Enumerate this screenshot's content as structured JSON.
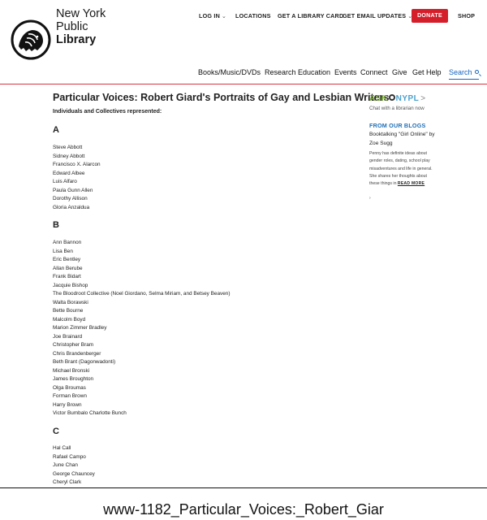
{
  "brand": {
    "line1": "New York",
    "line2": "Public",
    "line3": "Library",
    "logo_icon": "lion-logo-icon"
  },
  "utility_nav": {
    "login": "LOG IN",
    "locations": "LOCATIONS",
    "library_card": "GET A LIBRARY CARD",
    "email_updates": "GET EMAIL UPDATES",
    "donate": "DONATE",
    "shop": "SHOP",
    "caret": "⌄"
  },
  "main_nav": {
    "items": [
      "Books/Music/DVDs",
      "Research",
      "Education",
      "Events",
      "Connect",
      "Give",
      "Get Help"
    ],
    "search": "Search"
  },
  "colors": {
    "accent_red": "#d41f2b",
    "rule_red": "#d6373f",
    "link_blue": "#1565c0",
    "ask_green": "#7aab3a",
    "blog_blue": "#1e6fb5"
  },
  "article": {
    "title": "Particular Voices: Robert Giard's Portraits of Gay and Lesbian Writers",
    "subtitle": "Individuals and Collectives represented:",
    "sections": [
      {
        "letter": "A",
        "names": [
          "Steve Abbott",
          "Sidney Abbott",
          "Francisco X. Alarcon",
          "Edward Albee",
          "Luis Alfaro",
          "Paula Gunn Allen",
          "Dorothy Allison",
          "Gloria Anzaldua"
        ]
      },
      {
        "letter": "B",
        "names": [
          "Ann Bannon",
          "Lisa Ben",
          "Eric Bentley",
          "Allan Berube",
          "Frank Bidart",
          "Jacquie Bishop",
          "The Bloodroot Collective (Noel Giordano, Selma Miriam, and Betsey Beaven)",
          "Walta Borawski",
          "Bette Bourne",
          "Malcolm Boyd",
          "Marion Zimmer Bradley",
          "Joe Brainard",
          "Christopher Bram",
          "Chris Brandenberger",
          "Beth Brant (Dagonwadonti)",
          "Michael Bronski",
          "James Broughton",
          "Olga Broumas",
          "Forman Brown",
          "Harry Brown",
          "Victor Bumbalo Charlotte Bunch"
        ]
      },
      {
        "letter": "C",
        "names": [
          "Hal Call",
          "Rafael Campo",
          "June Chan",
          "George Chauncey",
          "Cheryl Clark"
        ]
      }
    ]
  },
  "sidebar": {
    "ask_part1": "ASK",
    "ask_part2": "NYPL",
    "ask_arrow": ">",
    "chat": "Chat with a librarian now",
    "blogs_heading": "FROM OUR BLOGS",
    "blog_title": "Booktalking \"Girl Online\" by Zoe Sugg",
    "blog_excerpt": "Penny has definite ideas about gender roles, dating, school play misadventures and life in general. She shares her thoughts about these things in",
    "read_more": "READ MORE",
    "blog_tail": "›"
  },
  "caption": "www-1182_Particular_Voices:_Robert_Giar"
}
